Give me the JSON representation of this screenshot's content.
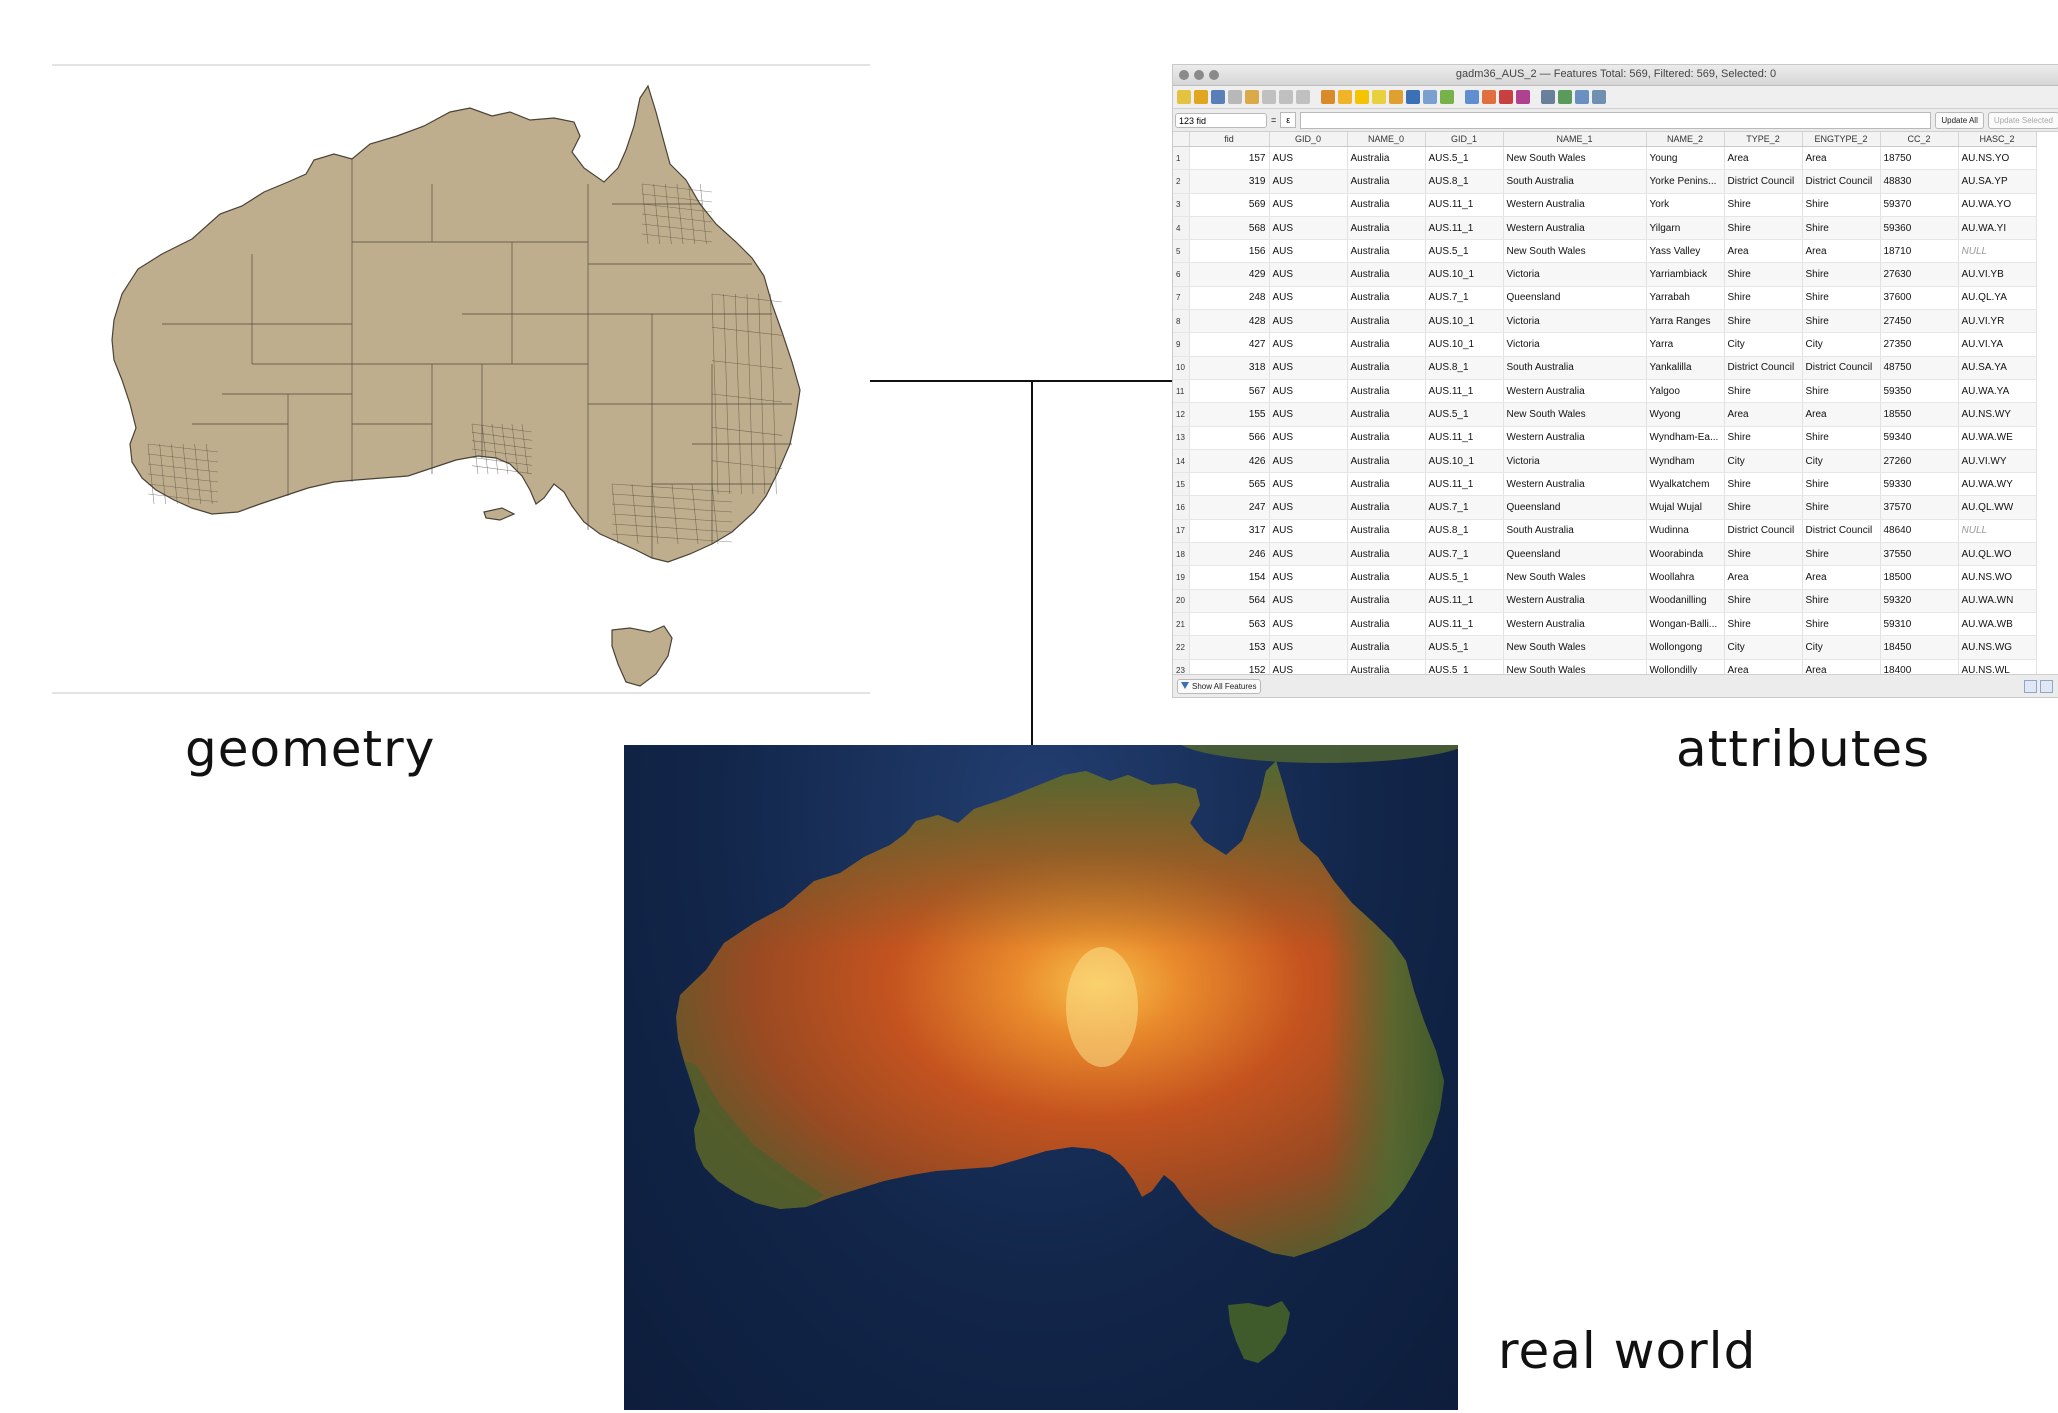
{
  "captions": {
    "geometry": "geometry",
    "attributes": "attributes",
    "real_world": "real world"
  },
  "attribute_table": {
    "window_title": "gadm36_AUS_2 — Features Total: 569, Filtered: 569, Selected: 0",
    "field_selector": "123 fid",
    "expression_equals": "=",
    "expression_button": "ε",
    "update_all_label": "Update All",
    "update_selected_label": "Update Selected",
    "show_all_label": "Show All Features",
    "null_label": "NULL",
    "columns": [
      "fid",
      "GID_0",
      "NAME_0",
      "GID_1",
      "NAME_1",
      "NAME_2",
      "TYPE_2",
      "ENGTYPE_2",
      "CC_2",
      "HASC_2"
    ],
    "rows": [
      {
        "n": "1",
        "fid": "157",
        "GID_0": "AUS",
        "NAME_0": "Australia",
        "GID_1": "AUS.5_1",
        "NAME_1": "New South Wales",
        "NAME_2": "Young",
        "TYPE_2": "Area",
        "ENGTYPE_2": "Area",
        "CC_2": "18750",
        "HASC_2": "AU.NS.YO"
      },
      {
        "n": "2",
        "fid": "319",
        "GID_0": "AUS",
        "NAME_0": "Australia",
        "GID_1": "AUS.8_1",
        "NAME_1": "South Australia",
        "NAME_2": "Yorke Penins...",
        "TYPE_2": "District Council",
        "ENGTYPE_2": "District Council",
        "CC_2": "48830",
        "HASC_2": "AU.SA.YP"
      },
      {
        "n": "3",
        "fid": "569",
        "GID_0": "AUS",
        "NAME_0": "Australia",
        "GID_1": "AUS.11_1",
        "NAME_1": "Western Australia",
        "NAME_2": "York",
        "TYPE_2": "Shire",
        "ENGTYPE_2": "Shire",
        "CC_2": "59370",
        "HASC_2": "AU.WA.YO"
      },
      {
        "n": "4",
        "fid": "568",
        "GID_0": "AUS",
        "NAME_0": "Australia",
        "GID_1": "AUS.11_1",
        "NAME_1": "Western Australia",
        "NAME_2": "Yilgarn",
        "TYPE_2": "Shire",
        "ENGTYPE_2": "Shire",
        "CC_2": "59360",
        "HASC_2": "AU.WA.YI"
      },
      {
        "n": "5",
        "fid": "156",
        "GID_0": "AUS",
        "NAME_0": "Australia",
        "GID_1": "AUS.5_1",
        "NAME_1": "New South Wales",
        "NAME_2": "Yass Valley",
        "TYPE_2": "Area",
        "ENGTYPE_2": "Area",
        "CC_2": "18710",
        "HASC_2": null
      },
      {
        "n": "6",
        "fid": "429",
        "GID_0": "AUS",
        "NAME_0": "Australia",
        "GID_1": "AUS.10_1",
        "NAME_1": "Victoria",
        "NAME_2": "Yarriambiack",
        "TYPE_2": "Shire",
        "ENGTYPE_2": "Shire",
        "CC_2": "27630",
        "HASC_2": "AU.VI.YB"
      },
      {
        "n": "7",
        "fid": "248",
        "GID_0": "AUS",
        "NAME_0": "Australia",
        "GID_1": "AUS.7_1",
        "NAME_1": "Queensland",
        "NAME_2": "Yarrabah",
        "TYPE_2": "Shire",
        "ENGTYPE_2": "Shire",
        "CC_2": "37600",
        "HASC_2": "AU.QL.YA"
      },
      {
        "n": "8",
        "fid": "428",
        "GID_0": "AUS",
        "NAME_0": "Australia",
        "GID_1": "AUS.10_1",
        "NAME_1": "Victoria",
        "NAME_2": "Yarra Ranges",
        "TYPE_2": "Shire",
        "ENGTYPE_2": "Shire",
        "CC_2": "27450",
        "HASC_2": "AU.VI.YR"
      },
      {
        "n": "9",
        "fid": "427",
        "GID_0": "AUS",
        "NAME_0": "Australia",
        "GID_1": "AUS.10_1",
        "NAME_1": "Victoria",
        "NAME_2": "Yarra",
        "TYPE_2": "City",
        "ENGTYPE_2": "City",
        "CC_2": "27350",
        "HASC_2": "AU.VI.YA"
      },
      {
        "n": "10",
        "fid": "318",
        "GID_0": "AUS",
        "NAME_0": "Australia",
        "GID_1": "AUS.8_1",
        "NAME_1": "South Australia",
        "NAME_2": "Yankalilla",
        "TYPE_2": "District Council",
        "ENGTYPE_2": "District Council",
        "CC_2": "48750",
        "HASC_2": "AU.SA.YA"
      },
      {
        "n": "11",
        "fid": "567",
        "GID_0": "AUS",
        "NAME_0": "Australia",
        "GID_1": "AUS.11_1",
        "NAME_1": "Western Australia",
        "NAME_2": "Yalgoo",
        "TYPE_2": "Shire",
        "ENGTYPE_2": "Shire",
        "CC_2": "59350",
        "HASC_2": "AU.WA.YA"
      },
      {
        "n": "12",
        "fid": "155",
        "GID_0": "AUS",
        "NAME_0": "Australia",
        "GID_1": "AUS.5_1",
        "NAME_1": "New South Wales",
        "NAME_2": "Wyong",
        "TYPE_2": "Area",
        "ENGTYPE_2": "Area",
        "CC_2": "18550",
        "HASC_2": "AU.NS.WY"
      },
      {
        "n": "13",
        "fid": "566",
        "GID_0": "AUS",
        "NAME_0": "Australia",
        "GID_1": "AUS.11_1",
        "NAME_1": "Western Australia",
        "NAME_2": "Wyndham-Ea...",
        "TYPE_2": "Shire",
        "ENGTYPE_2": "Shire",
        "CC_2": "59340",
        "HASC_2": "AU.WA.WE"
      },
      {
        "n": "14",
        "fid": "426",
        "GID_0": "AUS",
        "NAME_0": "Australia",
        "GID_1": "AUS.10_1",
        "NAME_1": "Victoria",
        "NAME_2": "Wyndham",
        "TYPE_2": "City",
        "ENGTYPE_2": "City",
        "CC_2": "27260",
        "HASC_2": "AU.VI.WY"
      },
      {
        "n": "15",
        "fid": "565",
        "GID_0": "AUS",
        "NAME_0": "Australia",
        "GID_1": "AUS.11_1",
        "NAME_1": "Western Australia",
        "NAME_2": "Wyalkatchem",
        "TYPE_2": "Shire",
        "ENGTYPE_2": "Shire",
        "CC_2": "59330",
        "HASC_2": "AU.WA.WY"
      },
      {
        "n": "16",
        "fid": "247",
        "GID_0": "AUS",
        "NAME_0": "Australia",
        "GID_1": "AUS.7_1",
        "NAME_1": "Queensland",
        "NAME_2": "Wujal Wujal",
        "TYPE_2": "Shire",
        "ENGTYPE_2": "Shire",
        "CC_2": "37570",
        "HASC_2": "AU.QL.WW"
      },
      {
        "n": "17",
        "fid": "317",
        "GID_0": "AUS",
        "NAME_0": "Australia",
        "GID_1": "AUS.8_1",
        "NAME_1": "South Australia",
        "NAME_2": "Wudinna",
        "TYPE_2": "District Council",
        "ENGTYPE_2": "District Council",
        "CC_2": "48640",
        "HASC_2": null
      },
      {
        "n": "18",
        "fid": "246",
        "GID_0": "AUS",
        "NAME_0": "Australia",
        "GID_1": "AUS.7_1",
        "NAME_1": "Queensland",
        "NAME_2": "Woorabinda",
        "TYPE_2": "Shire",
        "ENGTYPE_2": "Shire",
        "CC_2": "37550",
        "HASC_2": "AU.QL.WO"
      },
      {
        "n": "19",
        "fid": "154",
        "GID_0": "AUS",
        "NAME_0": "Australia",
        "GID_1": "AUS.5_1",
        "NAME_1": "New South Wales",
        "NAME_2": "Woollahra",
        "TYPE_2": "Area",
        "ENGTYPE_2": "Area",
        "CC_2": "18500",
        "HASC_2": "AU.NS.WO"
      },
      {
        "n": "20",
        "fid": "564",
        "GID_0": "AUS",
        "NAME_0": "Australia",
        "GID_1": "AUS.11_1",
        "NAME_1": "Western Australia",
        "NAME_2": "Woodanilling",
        "TYPE_2": "Shire",
        "ENGTYPE_2": "Shire",
        "CC_2": "59320",
        "HASC_2": "AU.WA.WN"
      },
      {
        "n": "21",
        "fid": "563",
        "GID_0": "AUS",
        "NAME_0": "Australia",
        "GID_1": "AUS.11_1",
        "NAME_1": "Western Australia",
        "NAME_2": "Wongan-Balli...",
        "TYPE_2": "Shire",
        "ENGTYPE_2": "Shire",
        "CC_2": "59310",
        "HASC_2": "AU.WA.WB"
      },
      {
        "n": "22",
        "fid": "153",
        "GID_0": "AUS",
        "NAME_0": "Australia",
        "GID_1": "AUS.5_1",
        "NAME_1": "New South Wales",
        "NAME_2": "Wollongong",
        "TYPE_2": "City",
        "ENGTYPE_2": "City",
        "CC_2": "18450",
        "HASC_2": "AU.NS.WG"
      },
      {
        "n": "23",
        "fid": "152",
        "GID_0": "AUS",
        "NAME_0": "Australia",
        "GID_1": "AUS.5_1",
        "NAME_1": "New South Wales",
        "NAME_2": "Wollondilly",
        "TYPE_2": "Area",
        "ENGTYPE_2": "Area",
        "CC_2": "18400",
        "HASC_2": "AU.NS.WL"
      }
    ]
  },
  "colors": {
    "geometry_fill": "#bfae8e",
    "geometry_stroke": "#4a4236",
    "ocean_dark": "#12264a",
    "desert_red": "#b9441c",
    "desert_orange": "#e07a2a",
    "vegetation_green": "#4f6a32",
    "connector_line": "#111111"
  }
}
